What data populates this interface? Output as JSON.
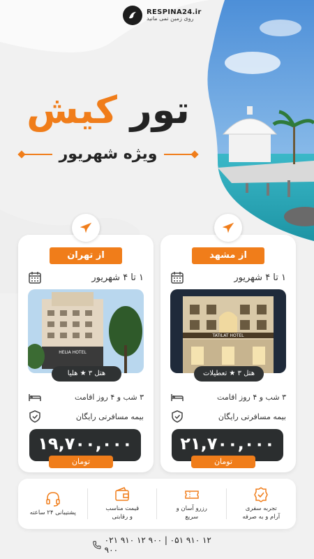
{
  "brand": {
    "name": "RESPINA24.ir",
    "tagline": "روی زمین نمی مانید"
  },
  "hero": {
    "title_part1": "تور",
    "title_part2": "کیش",
    "subtitle": "ویژه شهریور"
  },
  "packages": [
    {
      "origin": "از تهران",
      "dates": "۱ تا ۴ شهریور",
      "hotel": "هتل ۳ ★ هلیا",
      "hotel_sign": "HELIA HOTEL",
      "stay": "۳ شب و ۴ روز اقامت",
      "insurance": "بیمه مسافرتی رایگان",
      "price": "۱۹,۷۰۰,۰۰۰",
      "currency": "تومان"
    },
    {
      "origin": "از مشهد",
      "dates": "۱ تا ۴ شهریور",
      "hotel": "هتل ۳ ★ تعطیلات",
      "hotel_sign": "TATILAT HOTEL",
      "stay": "۳ شب و ۴ روز اقامت",
      "insurance": "بیمه مسافرتی رایگان",
      "price": "۲۱,۷۰۰,۰۰۰",
      "currency": "تومان"
    }
  ],
  "features": [
    {
      "icon": "medal-check-icon",
      "label": "تجربه سفری\nآرام و به صرفه"
    },
    {
      "icon": "ticket-icon",
      "label": "رزرو آسان و\nسریع"
    },
    {
      "icon": "wallet-icon",
      "label": "قیمت مناسب\nو رقابتی"
    },
    {
      "icon": "headset-icon",
      "label": "پشتیبانی ۲۴ ساعته"
    }
  ],
  "contact": {
    "phones": "۰۲۱ ۹۱۰ ۱۲ ۹۰۰ | ۰۵۱ ۹۱۰ ۱۲ ۹۰۰"
  },
  "colors": {
    "accent": "#f07d1a",
    "dark": "#2b2e2f",
    "background": "#f1f1f1"
  }
}
